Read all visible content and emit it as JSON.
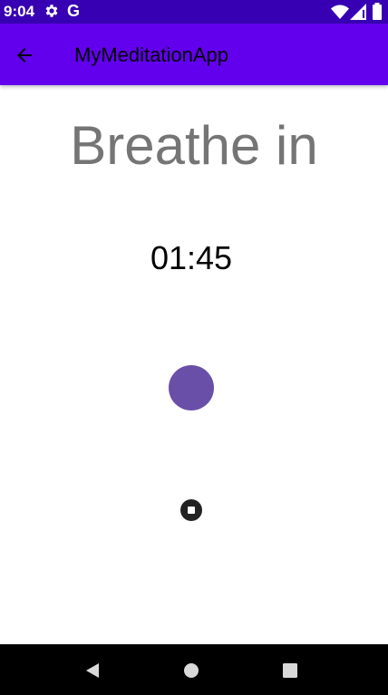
{
  "status_bar": {
    "time": "9:04",
    "icons": [
      "gear-icon",
      "google-icon",
      "wifi-icon",
      "signal-icon",
      "battery-icon"
    ],
    "google_glyph": "G"
  },
  "app_bar": {
    "title": "MyMeditationApp",
    "nav_icon": "arrow-back-icon"
  },
  "main": {
    "instruction": "Breathe in",
    "timer": "01:45",
    "stop_icon": "stop-icon"
  },
  "colors": {
    "status_bar": "#3700b3",
    "app_bar": "#6200ee",
    "instruction_text": "#757575",
    "breath_circle": "#6a4fa8",
    "nav_bar": "#000000"
  },
  "nav_bar": {
    "buttons": [
      "back-icon",
      "home-icon",
      "recents-icon"
    ]
  }
}
